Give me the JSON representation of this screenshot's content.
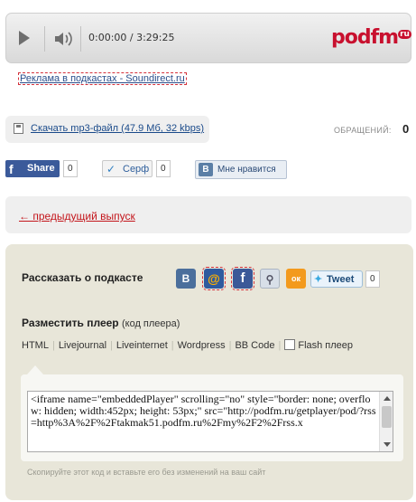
{
  "player": {
    "time": "0:00:00 / 3:29:25",
    "logo": "podfm",
    "logo_suffix": "ru"
  },
  "ad_link": "Реклама в подкастах - Soundirect.ru",
  "download": {
    "label": "Скачать mp3-файл (47.9 Мб, 32 kbps)"
  },
  "calls": {
    "label": "ОБРАЩЕНИЙ:",
    "value": "0"
  },
  "social_bar": {
    "facebook_label": "Share",
    "facebook_count": "0",
    "serf_label": "Серф",
    "serf_count": "0",
    "vk_letter": "B",
    "vk_label": "Мне нравится"
  },
  "prev_link": "← предыдущий выпуск",
  "share_panel": {
    "title": "Рассказать о подкасте",
    "vk_letter": "B",
    "mail_letter": "@",
    "fb_letter": "f",
    "ok_letter": "ок",
    "tweet_label": "Tweet",
    "tweet_count": "0"
  },
  "embed": {
    "title": "Разместить плеер",
    "code_link": "(код плеера)",
    "tabs": [
      "HTML",
      "Livejournal",
      "Liveinternet",
      "Wordpress",
      "BB Code"
    ],
    "flash_label": "Flash плеер",
    "code": "<iframe name=\"embeddedPlayer\" scrolling=\"no\" style=\"border: none; overflow: hidden; width:452px; height: 53px;\" src=\"http://podfm.ru/getplayer/pod/?rss=http%3A%2F%2Ftakmak51.podfm.ru%2Fmy%2F2%2Frss.x",
    "hint": "Скопируйте этот код и вставьте его без изменений на ваш сайт"
  }
}
